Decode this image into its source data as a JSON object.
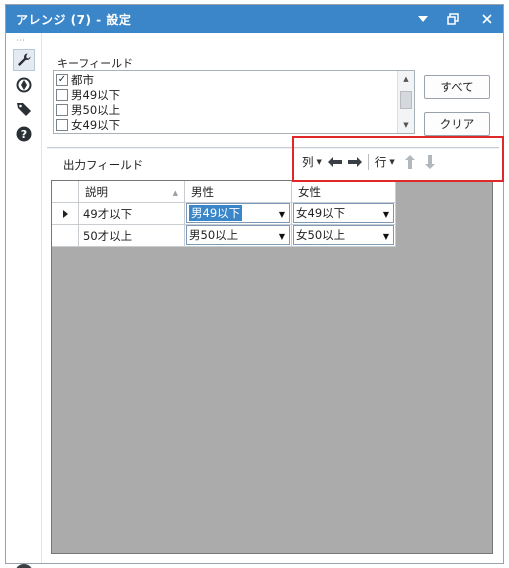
{
  "window": {
    "title": "アレンジ (7) - 設定",
    "controls": {
      "dropdown_icon": "caret-down-icon",
      "restore_icon": "restore-icon",
      "close_icon": "close-icon"
    }
  },
  "sidebar": {
    "items": [
      {
        "icon": "wrench-icon",
        "active": true
      },
      {
        "icon": "target-icon",
        "active": false
      },
      {
        "icon": "tag-icon",
        "active": false
      },
      {
        "icon": "help-icon",
        "active": false
      }
    ],
    "footer_icon": "checkmark-circle-icon"
  },
  "key_fields": {
    "label": "キーフィールド",
    "items": [
      {
        "label": "都市",
        "checked": true
      },
      {
        "label": "男49以下",
        "checked": false
      },
      {
        "label": "男50以上",
        "checked": false
      },
      {
        "label": "女49以下",
        "checked": false
      }
    ],
    "select_all_label": "すべて",
    "clear_label": "クリア"
  },
  "output_fields": {
    "label": "出力フィールド",
    "toolbar": {
      "column_label": "列",
      "row_label": "行",
      "left_arrow_icon": "arrow-left-icon",
      "right_arrow_icon": "arrow-right-icon",
      "up_arrow_icon": "arrow-up-icon",
      "down_arrow_icon": "arrow-down-icon"
    },
    "columns": [
      "説明",
      "男性",
      "女性"
    ],
    "rows": [
      {
        "description": "49才以下",
        "male": "男49以下",
        "female": "女49以下",
        "current": true
      },
      {
        "description": "50才以上",
        "male": "男50以上",
        "female": "女50以上",
        "current": false
      }
    ]
  },
  "colors": {
    "title_bar": "#3a86c8",
    "highlight_box": "#e0272a",
    "grid_background": "#ababab",
    "selection": "#3a86c8"
  }
}
